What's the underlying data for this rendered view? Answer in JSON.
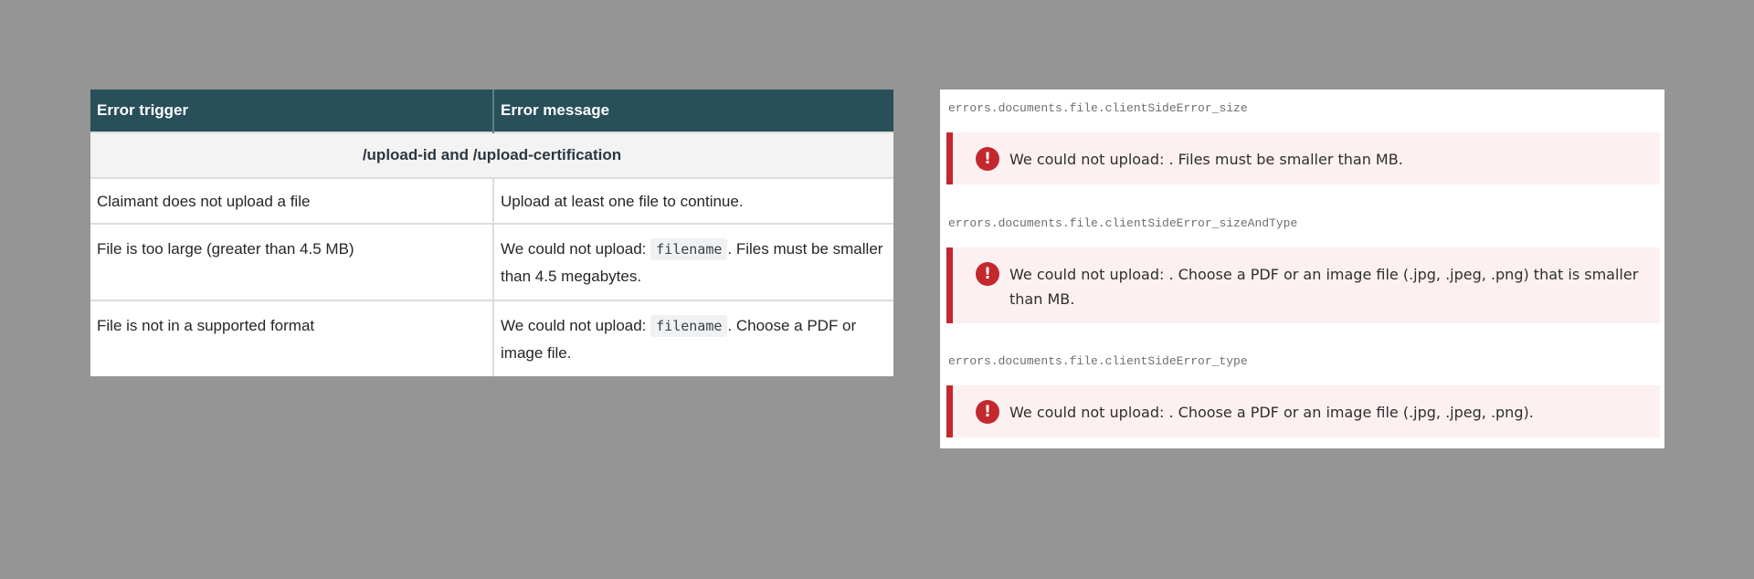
{
  "table": {
    "headers": [
      "Error trigger",
      "Error message"
    ],
    "section_title": "/upload-id and /upload-certification",
    "rows": [
      {
        "trigger": "Claimant does not upload a file",
        "message_prefix": "Upload at least one file to continue.",
        "code": "",
        "message_suffix": ""
      },
      {
        "trigger": "File is too large (greater than 4.5 MB)",
        "message_prefix": "We could not upload: ",
        "code": "filename",
        "message_suffix": ". Files must be smaller than 4.5 megabytes."
      },
      {
        "trigger": "File is not in a supported format",
        "message_prefix": "We could not upload: ",
        "code": "filename",
        "message_suffix": ". Choose a PDF or image file."
      }
    ]
  },
  "panel": {
    "entries": [
      {
        "key": "errors.documents.file.clientSideError_size",
        "message": "We could not upload: . Files must be smaller than MB."
      },
      {
        "key": "errors.documents.file.clientSideError_sizeAndType",
        "message": "We could not upload: . Choose a PDF or an image file (.jpg, .jpeg, .png) that is smaller than MB."
      },
      {
        "key": "errors.documents.file.clientSideError_type",
        "message": "We could not upload: . Choose a PDF or an image file (.jpg, .jpeg, .png)."
      }
    ],
    "alert_icon": "!"
  },
  "colors": {
    "background": "#959595",
    "table_header": "#284f5a",
    "alert_border": "#c3282e",
    "alert_background": "#fdf0f1"
  }
}
